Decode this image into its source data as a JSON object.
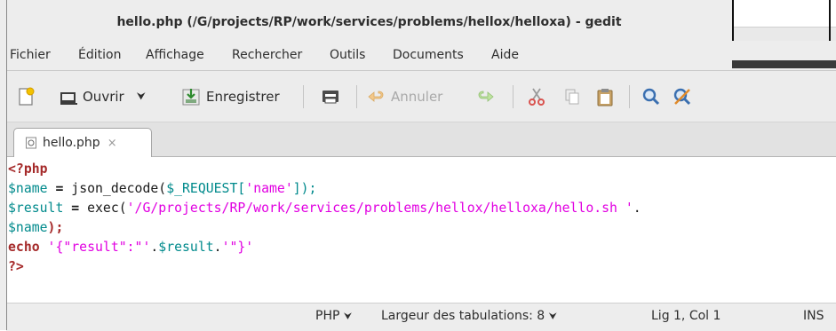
{
  "window": {
    "title": "hello.php (/G/projects/RP/work/services/problems/hellox/helloxa) - gedit"
  },
  "menu": {
    "items": [
      "Fichier",
      "Édition",
      "Affichage",
      "Rechercher",
      "Outils",
      "Documents",
      "Aide"
    ]
  },
  "toolbar": {
    "open_label": "Ouvrir",
    "save_label": "Enregistrer",
    "undo_label": "Annuler"
  },
  "tab": {
    "label": "hello.php",
    "close_glyph": "×"
  },
  "code": {
    "line1": "<?php",
    "line2_var": "$name",
    "line2_eq": " = ",
    "line2_fn": "json_decode(",
    "line2_arg": "$_REQUEST[",
    "line2_str": "'name'",
    "line2_end": "]);",
    "line3_var": "$result",
    "line3_eq": " = ",
    "line3_fn": "exec(",
    "line3_str": "'/G/projects/RP/work/services/problems/hellox/helloxa/hello.sh '",
    "line3_dot": ".",
    "line4_var": "$name",
    "line4_end": ");",
    "line5_kw": "echo",
    "line5_str1": " '{\"result\":\"'",
    "line5_dot1": ".",
    "line5_var": "$result",
    "line5_dot2": ".",
    "line5_str2": "'\"}'",
    "line6": "?>"
  },
  "status": {
    "language": "PHP",
    "tab_width": "Largeur des tabulations: 8",
    "position": "Lig 1, Col 1",
    "mode": "INS"
  },
  "colors": {
    "keyword": "#a52a2a",
    "variable": "#008a8c",
    "string": "#e100e1"
  }
}
